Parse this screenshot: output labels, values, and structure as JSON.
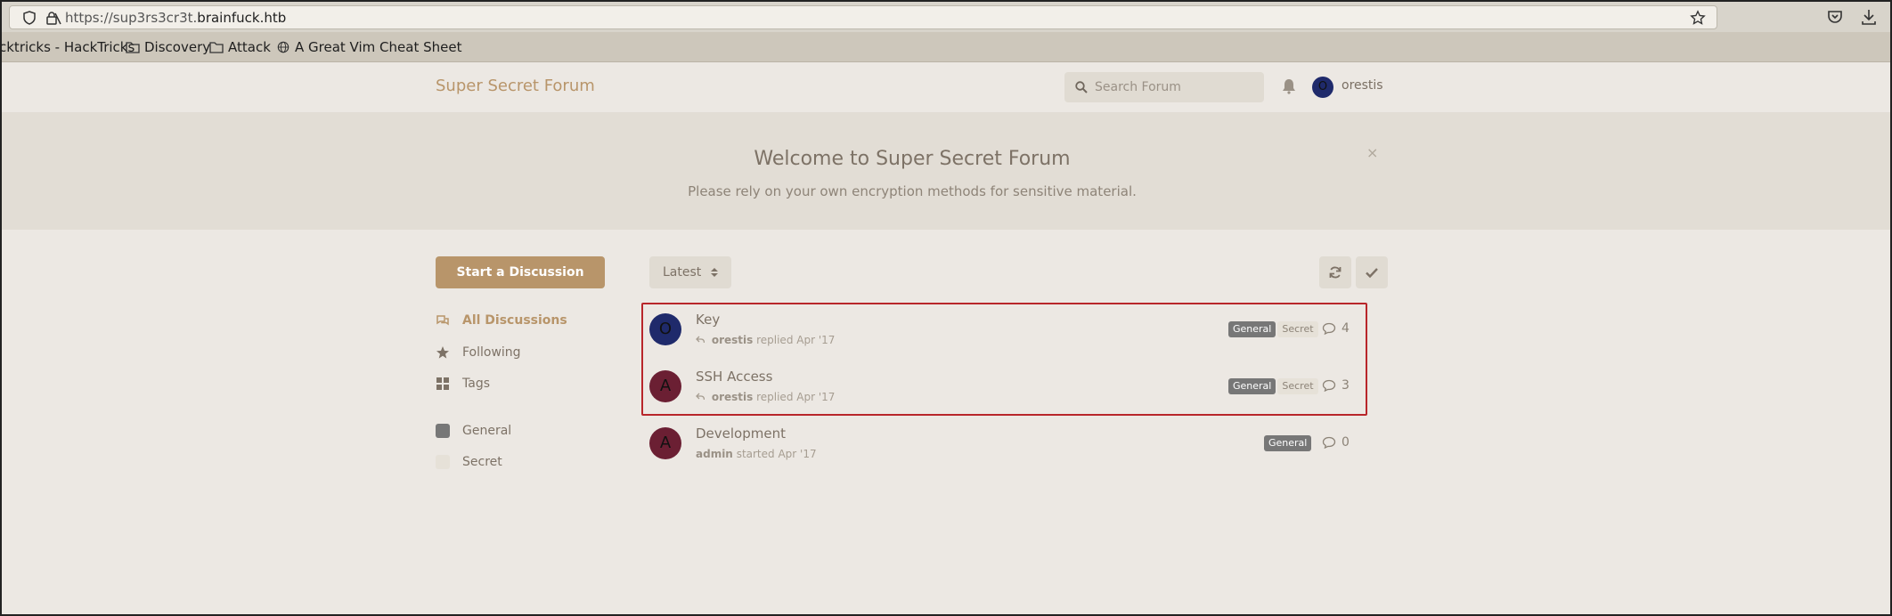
{
  "browser": {
    "url_prefix": "https://sup3rs3cr3t.",
    "url_host": "brainfuck.htb",
    "bookmarks": [
      {
        "label": "cktricks - HackTricks",
        "icon": "none"
      },
      {
        "label": "Discovery",
        "icon": "folder-icon"
      },
      {
        "label": "Attack",
        "icon": "folder-icon"
      },
      {
        "label": "A Great Vim Cheat Sheet",
        "icon": "globe-icon"
      }
    ]
  },
  "header": {
    "brand": "Super Secret Forum",
    "search_placeholder": "Search Forum",
    "username": "orestis",
    "avatar_letter": "O"
  },
  "hero": {
    "title": "Welcome to Super Secret Forum",
    "subtitle": "Please rely on your own encryption methods for sensitive material.",
    "close": "×"
  },
  "sidebar": {
    "start_button": "Start a Discussion",
    "nav": [
      {
        "label": "All Discussions",
        "icon": "comments-icon",
        "active": true
      },
      {
        "label": "Following",
        "icon": "star-icon",
        "active": false
      },
      {
        "label": "Tags",
        "icon": "th-large-icon",
        "active": false
      }
    ],
    "tags": [
      {
        "label": "General",
        "color": "#777777"
      },
      {
        "label": "Secret",
        "color": "#e6e1d8"
      }
    ]
  },
  "toolbar": {
    "sort_label": "Latest"
  },
  "discussions": [
    {
      "title": "Key",
      "avatar": "O",
      "avatar_color": "#1f2a6b",
      "user": "orestis",
      "action": "replied",
      "date": "Apr '17",
      "reply_icon": true,
      "tags": [
        "General",
        "Secret"
      ],
      "count": "4"
    },
    {
      "title": "SSH Access",
      "avatar": "A",
      "avatar_color": "#6b1f33",
      "user": "orestis",
      "action": "replied",
      "date": "Apr '17",
      "reply_icon": true,
      "tags": [
        "General",
        "Secret"
      ],
      "count": "3"
    },
    {
      "title": "Development",
      "avatar": "A",
      "avatar_color": "#6b1f33",
      "user": "admin",
      "action": "started",
      "date": "Apr '17",
      "reply_icon": false,
      "tags": [
        "General"
      ],
      "count": "0"
    }
  ],
  "colors": {
    "accent": "#b8956a",
    "highlight": "#b8262a"
  }
}
